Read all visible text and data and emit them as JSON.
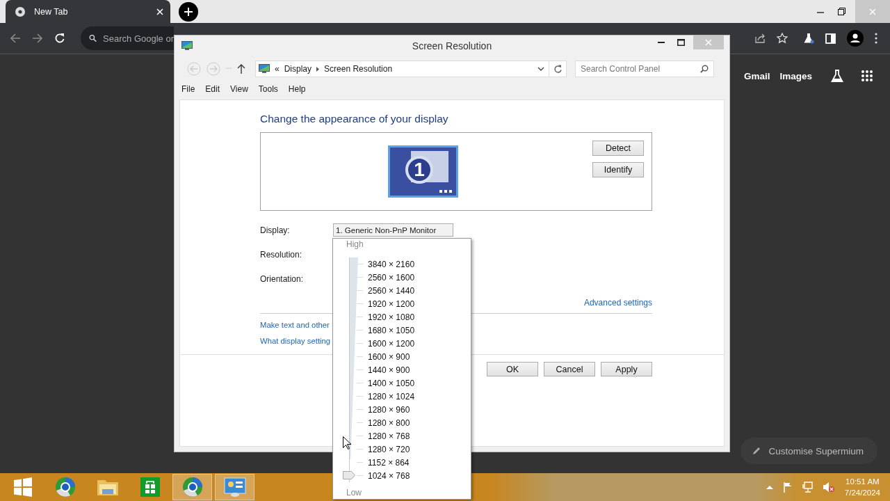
{
  "browser": {
    "tab": {
      "title": "New Tab"
    },
    "omnibox": {
      "placeholder": "Search Google or"
    },
    "links": [
      "Gmail",
      "Images"
    ],
    "customise_button": "Customise Supermium"
  },
  "window": {
    "title": "Screen Resolution",
    "breadcrumb": {
      "prefix": "«",
      "items": [
        "Display",
        "Screen Resolution"
      ]
    },
    "search": {
      "placeholder": "Search Control Panel"
    },
    "menu": [
      "File",
      "Edit",
      "View",
      "Tools",
      "Help"
    ],
    "heading": "Change the appearance of your display",
    "monitor": {
      "number": "1"
    },
    "side_buttons": [
      "Detect",
      "Identify"
    ],
    "fields": [
      {
        "label": "Display:",
        "value": "1. Generic Non-PnP Monitor"
      },
      {
        "label": "Resolution:"
      },
      {
        "label": "Orientation:"
      }
    ],
    "advanced_link": "Advanced settings",
    "links": [
      "Make text and other",
      "What display setting"
    ],
    "buttons": [
      "OK",
      "Cancel",
      "Apply"
    ]
  },
  "resolution_popup": {
    "high_label": "High",
    "low_label": "Low",
    "level": 0,
    "options": [
      "3840 × 2160",
      "2560 × 1600",
      "2560 × 1440",
      "1920 × 1200",
      "1920 × 1080",
      "1680 × 1050",
      "1600 × 1200",
      "1600 × 900",
      "1440 × 900",
      "1400 × 1050",
      "1280 × 1024",
      "1280 × 960",
      "1280 × 800",
      "1280 × 768",
      "1280 × 720",
      "1152 × 864",
      "1024 × 768"
    ]
  },
  "taskbar": {
    "apps": [
      {
        "kind": "start",
        "active": false
      },
      {
        "kind": "browser",
        "active": false
      },
      {
        "kind": "folder",
        "active": false
      },
      {
        "kind": "store",
        "active": false
      },
      {
        "kind": "browser",
        "active": true
      },
      {
        "kind": "control-panel",
        "active": true
      }
    ],
    "clock": {
      "time": "10:51 AM",
      "date": "7/24/2024"
    }
  }
}
